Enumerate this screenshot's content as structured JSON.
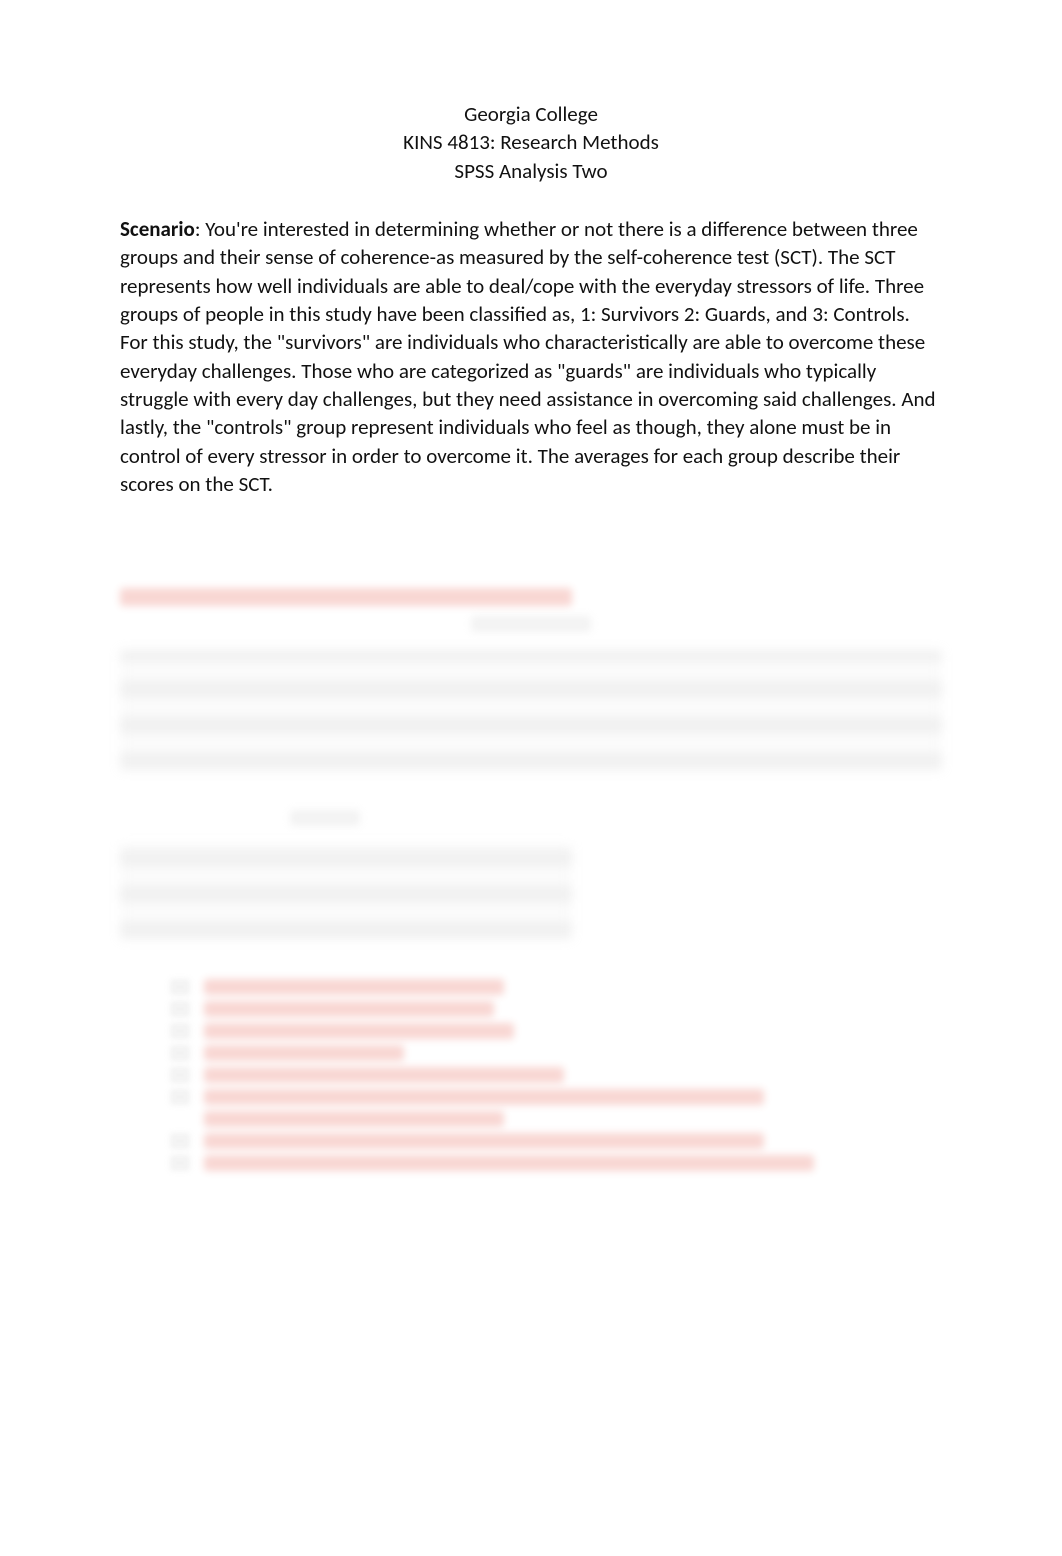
{
  "header": {
    "institution": "Georgia College",
    "course": "KINS 4813: Research Methods",
    "assignment": "SPSS Analysis Two"
  },
  "scenario": {
    "label": "Scenario",
    "text": ": You're interested in determining whether or not there is a difference between three groups and their sense of coherence-as measured by the self-coherence test (SCT). The SCT represents how well individuals are able to deal/cope with the everyday stressors of life.  Three groups of people in this study have been classified as, 1: Survivors 2: Guards, and 3: Controls. For this study, the \"survivors\" are individuals who characteristically are able to overcome these everyday challenges. Those who are categorized as \"guards\" are individuals who typically struggle with every day challenges, but they need assistance in overcoming said challenges. And lastly, the \"controls\" group represent individuals who feel as though, they alone must be in control of every stressor in order to overcome it. The averages for each group describe their scores on the SCT."
  },
  "obscured": {
    "note": "The lower portion of the document (SPSS output tables and question list) is blurred and not legible in the screenshot.",
    "visible_table_captions": [
      "[blurred]",
      "[blurred]"
    ],
    "question_count_estimate": 8
  }
}
